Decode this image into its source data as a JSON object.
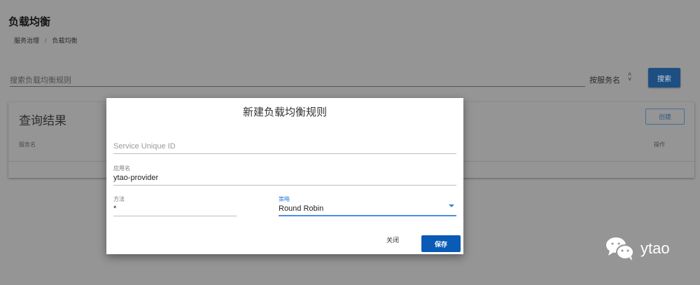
{
  "page": {
    "title": "负载均衡",
    "breadcrumb": [
      "服务治理",
      "负载均衡"
    ]
  },
  "search": {
    "placeholder": "搜索负载均衡规则",
    "filter_select": "按服务名",
    "button": "搜索"
  },
  "results": {
    "title": "查询结果",
    "create_button": "创建",
    "columns": [
      "服务名",
      "操作"
    ]
  },
  "dialog": {
    "title": "新建负载均衡规则",
    "service_id": {
      "placeholder": "Service Unique ID",
      "value": ""
    },
    "app_name": {
      "label": "应用名",
      "value": "ytao-provider"
    },
    "method": {
      "label": "方法",
      "value": "*"
    },
    "strategy": {
      "label": "策略",
      "value": "Round Robin"
    },
    "close_button": "关闭",
    "save_button": "保存"
  },
  "watermark": {
    "text": "ytao"
  },
  "colors": {
    "primary": "#0a5bb5",
    "focus": "#4b8fe0"
  }
}
